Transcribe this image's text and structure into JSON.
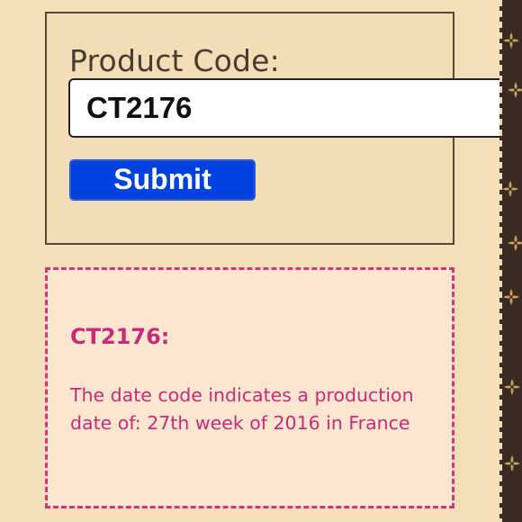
{
  "form": {
    "label": "Product Code:",
    "input_value": "CT2176",
    "submit_label": "Submit"
  },
  "result": {
    "code": "CT2176:",
    "message": "The date code indicates a production date of: 27th week of 2016 in France"
  },
  "colors": {
    "background": "#f5dfb8",
    "submit_button": "#0041e0",
    "result_text": "#c72a78",
    "result_border": "#d4357a",
    "side_strip": "#3b2a24",
    "monogram": "#c8a45a"
  },
  "icons": {
    "side_strip_pattern": "monogram-flower-icon"
  }
}
